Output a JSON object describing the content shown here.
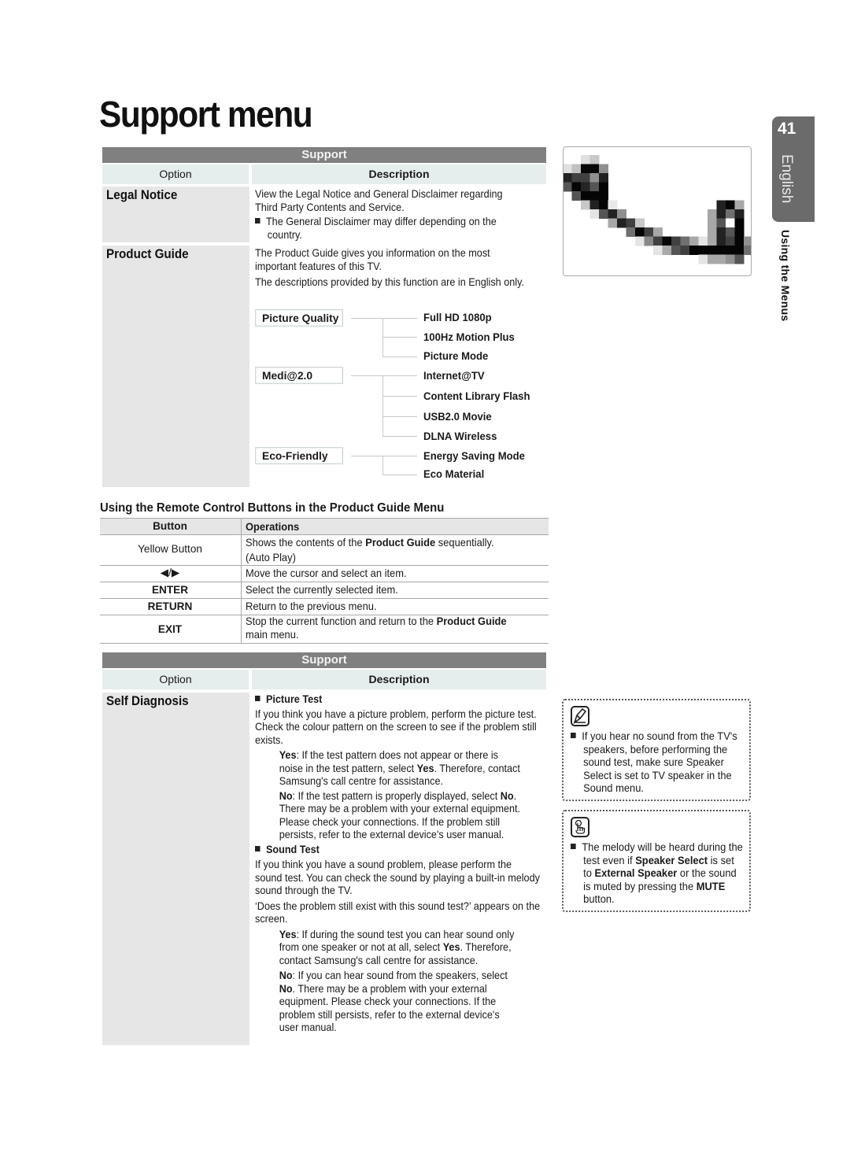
{
  "page": {
    "title": "Support menu",
    "page_number": "41",
    "language": "English",
    "section": "Using the Menus"
  },
  "table1": {
    "band": "Support",
    "col_option": "Option",
    "col_description": "Description",
    "rows": [
      {
        "option": "Legal Notice",
        "desc_lines": [
          "View the Legal Notice and General Disclaimer regarding",
          "Third Party Contents and Service."
        ],
        "bullet": "The General Disclaimer may differ depending on the country."
      },
      {
        "option": "Product Guide",
        "desc_p1": "The Product Guide gives you information on the most important features of this TV.",
        "desc_p2": "The descriptions provided by this function are in English only.",
        "tree": [
          {
            "group": "Picture Quality",
            "items": [
              "Full HD 1080p",
              "100Hz Motion Plus",
              "Picture Mode"
            ]
          },
          {
            "group": "Medi@2.0",
            "items": [
              "Internet@TV",
              "Content Library Flash",
              "USB2.0 Movie",
              "DLNA Wireless"
            ]
          },
          {
            "group": "Eco-Friendly",
            "items": [
              "Energy Saving Mode",
              "Eco Material"
            ]
          }
        ]
      }
    ]
  },
  "remote": {
    "title": "Using the Remote Control Buttons in the Product Guide Menu",
    "col_button": "Button",
    "col_operations": "Operations",
    "rows": [
      {
        "button": "Yellow Button",
        "op_pre": "Shows the contents of the ",
        "op_bold": "Product Guide",
        "op_post": " sequentially.",
        "op_line2": "(Auto Play)"
      },
      {
        "button": "◀/▶",
        "op": "Move the cursor and select an item."
      },
      {
        "button": "ENTER",
        "op": "Select the currently selected item."
      },
      {
        "button": "RETURN",
        "op": "Return to the previous menu."
      },
      {
        "button": "EXIT",
        "op_pre": "Stop the current function and return to the ",
        "op_bold": "Product Guide",
        "op_line2": "main menu."
      }
    ]
  },
  "table2": {
    "band": "Support",
    "col_option": "Option",
    "col_description": "Description",
    "option": "Self Diagnosis",
    "picture_test": {
      "heading": "Picture Test",
      "intro": "If you think you have a picture problem, perform the picture test. Check the colour pattern on the screen to see if the problem still exists.",
      "yes_label": "Yes",
      "yes_text_1": ": If the test pattern does not appear or there is noise in the test pattern, select ",
      "yes_bold": "Yes",
      "yes_text_2": ". Therefore, contact Samsung's call centre for assistance.",
      "no_label": "No",
      "no_text_1": ": If the test pattern is properly displayed, select ",
      "no_bold": "No",
      "no_text_2": ". There may be a problem with your external equipment. Please check your connections. If the problem still persists, refer to the external device's user manual."
    },
    "sound_test": {
      "heading": "Sound Test",
      "intro": "If you think you have a sound problem, please perform the sound test. You can check the sound by playing a built-in melody sound through the TV.",
      "prompt": "‘Does the problem still exist with this sound test?’ appears on the screen.",
      "yes_label": "Yes",
      "yes_text_1": ": If during the sound test you can hear sound only from one speaker or not at all, select ",
      "yes_bold": "Yes",
      "yes_text_2": ". Therefore, contact Samsung's call centre for assistance.",
      "no_label": "No",
      "no_text_1": ": If you can hear sound from the speakers, select ",
      "no_bold": "No",
      "no_text_2": ". There may be a problem with your external equipment. Please check your connections. If the problem still persists, refer to the external device's user manual."
    }
  },
  "notes": [
    {
      "icon": "note-pencil-icon",
      "text": "If you hear no sound from the TV's speakers, before performing the sound test, make sure Speaker Select is set to TV speaker in the Sound menu."
    },
    {
      "icon": "finger-press-icon",
      "pre": "The melody will be heard during the test even if ",
      "b1": "Speaker Select",
      "mid1": " is set to ",
      "b2": "External Speaker",
      "mid2": " or the sound is muted by pressing the ",
      "b3": "MUTE",
      "post": " button."
    }
  ],
  "figure": {
    "description": "magnified pixel detail (decorative)"
  }
}
